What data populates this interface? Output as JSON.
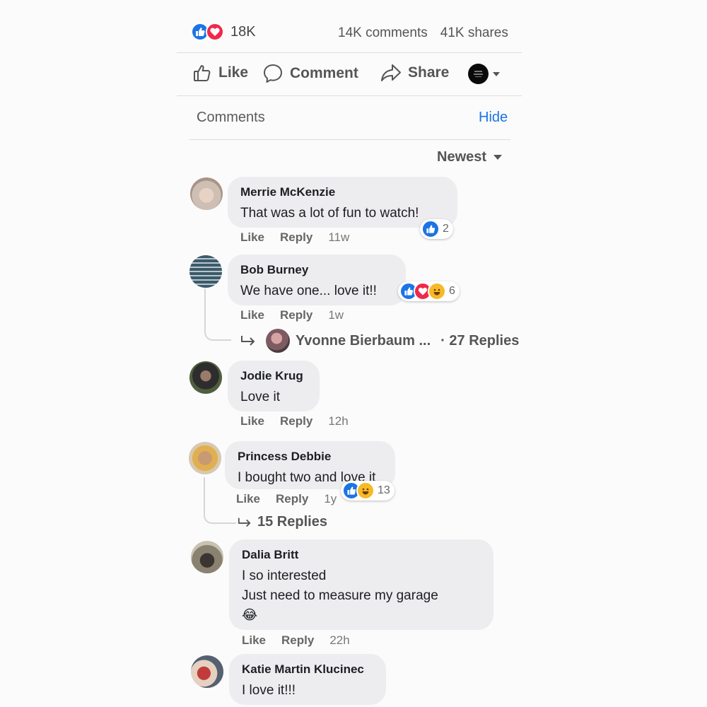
{
  "summary": {
    "reaction_count": "18K",
    "comments": "14K comments",
    "shares": "41K shares"
  },
  "actions": {
    "like": "Like",
    "comment": "Comment",
    "share": "Share"
  },
  "comments_header": {
    "title": "Comments",
    "hide": "Hide",
    "sort": "Newest"
  },
  "comments": [
    {
      "name": "Merrie McKenzie",
      "text": "That was a lot of fun to watch!",
      "like": "Like",
      "reply": "Reply",
      "time": "11w",
      "reactions": [
        "like"
      ],
      "reaction_count": "2"
    },
    {
      "name": "Bob Burney",
      "text": "We have one... love it!!",
      "like": "Like",
      "reply": "Reply",
      "time": "1w",
      "reactions": [
        "like",
        "love",
        "haha"
      ],
      "reaction_count": "6",
      "reply_preview": {
        "name": "Yvonne Bierbaum ...",
        "count": "· 27 Replies"
      }
    },
    {
      "name": "Jodie Krug",
      "text": "Love it",
      "like": "Like",
      "reply": "Reply",
      "time": "12h"
    },
    {
      "name": "Princess Debbie",
      "text": "I bought two and love it",
      "like": "Like",
      "reply": "Reply",
      "time": "1y",
      "reactions": [
        "like",
        "haha"
      ],
      "reaction_count": "13",
      "replies_link": "15 Replies"
    },
    {
      "name": "Dalia Britt",
      "text_lines": [
        "I so interested",
        "Just need to measure my garage",
        "😂"
      ],
      "like": "Like",
      "reply": "Reply",
      "time": "22h"
    },
    {
      "name": "Katie Martin Klucinec",
      "text": "I love it!!!"
    }
  ],
  "colors": {
    "accent": "#1b74e4",
    "love": "#f02849",
    "haha": "#f7b928",
    "bubble": "#ededf0"
  },
  "icons": [
    "like-reaction-icon",
    "love-reaction-icon",
    "haha-reaction-icon",
    "thumbs-up-icon",
    "comment-icon",
    "share-icon",
    "profile-avatar",
    "chevron-down-icon",
    "reply-arrow-icon"
  ]
}
